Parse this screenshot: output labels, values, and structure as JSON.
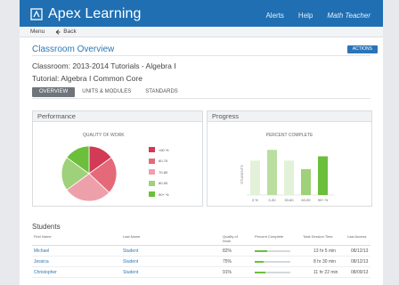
{
  "app": {
    "name": "Apex Learning"
  },
  "header": {
    "links": [
      "Alerts",
      "Help"
    ],
    "user": "Math Teacher"
  },
  "subnav": {
    "menu": "Menu",
    "back": "Back"
  },
  "page": {
    "title": "Classroom Overview",
    "actions_label": "ACTIONS",
    "classroom_line": "Classroom: 2013-2014 Tutorials - Algebra I",
    "tutorial_line": "Tutorial: Algebra I Common Core"
  },
  "tabs": [
    {
      "label": "OVERVIEW",
      "active": true
    },
    {
      "label": "UNITS & MODULES",
      "active": false
    },
    {
      "label": "STANDARDS",
      "active": false
    }
  ],
  "panels": {
    "performance": {
      "title": "Performance",
      "subtitle": "QUALITY OF WORK"
    },
    "progress": {
      "title": "Progress",
      "subtitle": "PERCENT COMPLETE",
      "ylabel": "STUDENTS"
    }
  },
  "chart_data": [
    {
      "type": "pie",
      "title": "QUALITY OF WORK",
      "categories": [
        "<60 %",
        "60-70",
        "70-80",
        "80-90",
        "90+ %"
      ],
      "values": [
        15,
        22,
        28,
        20,
        15
      ],
      "colors": [
        "#d23a55",
        "#e56a79",
        "#eea0aa",
        "#9fd07a",
        "#6cbf3b"
      ]
    },
    {
      "type": "bar",
      "title": "PERCENT COMPLETE",
      "ylabel": "STUDENTS",
      "categories": [
        "0 %",
        "0-30",
        "30-60",
        "60-90",
        "90+ %"
      ],
      "values": [
        8,
        10.5,
        8,
        6,
        9
      ],
      "ylim": [
        0,
        12
      ],
      "colors": [
        "#e3f1d8",
        "#b9dea0",
        "#e3f1d8",
        "#9fd07a",
        "#6cbf3b"
      ]
    }
  ],
  "students": {
    "title": "Students",
    "columns": [
      "First Name",
      "Last Name",
      "Quality of Work",
      "Percent Complete",
      "Total Session Time",
      "Last Access"
    ],
    "rows": [
      {
        "first": "Michael",
        "last": "Student",
        "quality": "82%",
        "complete": 0.35,
        "time": "13 hr 5 min",
        "access": "08/12/13"
      },
      {
        "first": "Jessica",
        "last": "Student",
        "quality": "75%",
        "complete": 0.25,
        "time": "8 hr 30 min",
        "access": "08/12/13"
      },
      {
        "first": "Christopher",
        "last": "Student",
        "quality": "91%",
        "complete": 0.3,
        "time": "11 hr 22 min",
        "access": "08/09/13"
      }
    ]
  }
}
